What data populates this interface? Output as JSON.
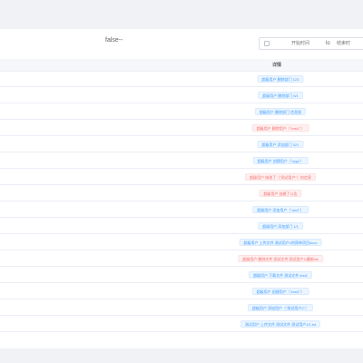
{
  "toolbar": {
    "status_text": "false--",
    "date_range": {
      "start_placeholder": "开始时间",
      "separator": "lo",
      "end_placeholder": "结束时"
    }
  },
  "table": {
    "detail_header": "详情",
    "rows": [
      {
        "text": "超级用户 删除部门 123",
        "color": "blue"
      },
      {
        "text": "超级用户 删除部门 6/1",
        "color": "blue"
      },
      {
        "text": "超级用户 删除部门 信息部",
        "color": "blue"
      },
      {
        "text": "超级用户 删除用户（\"test1\"）",
        "color": "red"
      },
      {
        "text": "超级用户 添加部门 321",
        "color": "blue"
      },
      {
        "text": "超级用户 创建用户（\"qqq\"）",
        "color": "blue"
      },
      {
        "text": "超级用户 修改了（\"测试用户\"）的信息",
        "color": "red"
      },
      {
        "text": "超级用户 创建了公告",
        "color": "red"
      },
      {
        "text": "超级用户 添加用户（\"ulu2\"）",
        "color": "blue"
      },
      {
        "text": "超级用户 添加部门 1/1",
        "color": "blue"
      },
      {
        "text": "超级用户 上传文件 测试用户1的简单项目docx",
        "color": "blue"
      },
      {
        "text": "超级用户 删除文件 测试文件 测试用户1/最新xls",
        "color": "red"
      },
      {
        "text": "超级用户 下载文件 测试文件 test1",
        "color": "blue"
      },
      {
        "text": "超级用户 创建用户（\"test1\"）",
        "color": "blue"
      },
      {
        "text": "超级用户 添加用户（\"测试用户2\"）",
        "color": "blue"
      },
      {
        "text": "测试用户 上传文件 测试文件 测试用户1/1.txt",
        "color": "blue"
      }
    ]
  },
  "colors": {
    "tag_blue_text": "#409eff",
    "tag_red_text": "#f56c6c",
    "background": "#f0f2f5"
  }
}
